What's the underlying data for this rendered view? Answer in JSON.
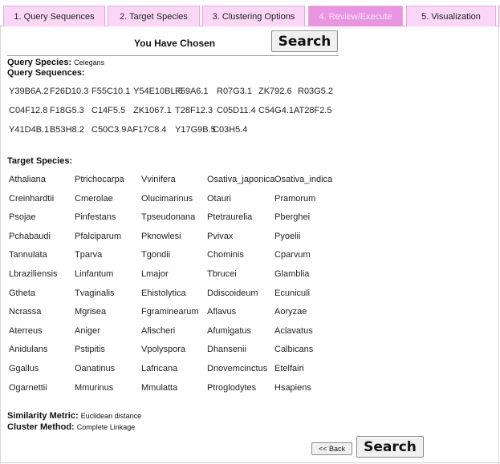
{
  "tabs": [
    {
      "label": "1. Query Sequences",
      "active": false
    },
    {
      "label": "2. Target Species",
      "active": false
    },
    {
      "label": "3. Clustering Options",
      "active": false
    },
    {
      "label": "4. Review/Execute",
      "active": true
    },
    {
      "label": "5. Visualization",
      "active": false
    }
  ],
  "summary": {
    "title": "You Have Chosen",
    "search_label": "Search",
    "query_species_label": "Query Species:",
    "query_species_value": "Celegans",
    "query_sequences_label": "Query Sequences:",
    "query_sequences": [
      [
        "Y39B6A.2",
        "F26D10.3",
        "F55C10.1",
        "Y54E10BL.6",
        "F59A6.1",
        "R07G3.1",
        "ZK792.6",
        "R03G5.2"
      ],
      [
        "C04F12.8",
        "F18G5.3",
        "C14F5.5",
        "ZK1067.1",
        "T28F12.3",
        "C05D11.4",
        "C54G4.1",
        "AT28F2.5"
      ],
      [
        "Y41D4B.1",
        "B53H8.2",
        "C50C3.9",
        "AF17C8.4",
        "Y17G9B.5",
        "C03H5.4"
      ]
    ],
    "target_species_label": "Target Species:",
    "target_species": [
      [
        "Athaliana",
        "Ptrichocarpa",
        "Vvinifera",
        "Osativa_japonica",
        "Osativa_indica"
      ],
      [
        "Creinhardtii",
        "Cmerolae",
        "Olucimarinus",
        "Otauri",
        "Pramorum"
      ],
      [
        "Psojae",
        "Pinfestans",
        "Tpseudonana",
        "Ptetraurelia",
        "Pberghei"
      ],
      [
        "Pchabaudi",
        "Pfalciparum",
        "Pknowlesi",
        "Pvivax",
        "Pyoelii"
      ],
      [
        "Tannulata",
        "Tparva",
        "Tgondii",
        "Chominis",
        "Cparvum"
      ],
      [
        "Lbraziliensis",
        "Linfantum",
        "Lmajor",
        "Tbrucei",
        "Glamblia"
      ],
      [
        "Gtheta",
        "Tvaginalis",
        "Ehistolytica",
        "Ddiscoideum",
        "Ecuniculi"
      ],
      [
        "Ncrassa",
        "Mgrisea",
        "Fgraminearum",
        "Aflavus",
        "Aoryzae"
      ],
      [
        "Aterreus",
        "Aniger",
        "Afischeri",
        "Afumigatus",
        "Aclavatus"
      ],
      [
        "Anidulans",
        "Pstipitis",
        "Vpolyspora",
        "Dhansenii",
        "Calbicans"
      ],
      [
        "Ggallus",
        "Oanatinus",
        "Lafricana",
        "Dnovemcinctus",
        "Etelfairi"
      ],
      [
        "Ogarnettii",
        "Mmurinus",
        "Mmulatta",
        "Ptroglodytes",
        "Hsapiens"
      ]
    ],
    "similarity_metric_label": "Similarity Metric:",
    "similarity_metric_value": "Euclidean distance",
    "cluster_method_label": "Cluster Method:",
    "cluster_method_value": "Complete Linkage",
    "back_label": "<< Back"
  },
  "colors": {
    "tab_bg": "#fbd6f6",
    "tab_active_bg": "#ea95e2",
    "tab_border": "#e3a9de"
  }
}
